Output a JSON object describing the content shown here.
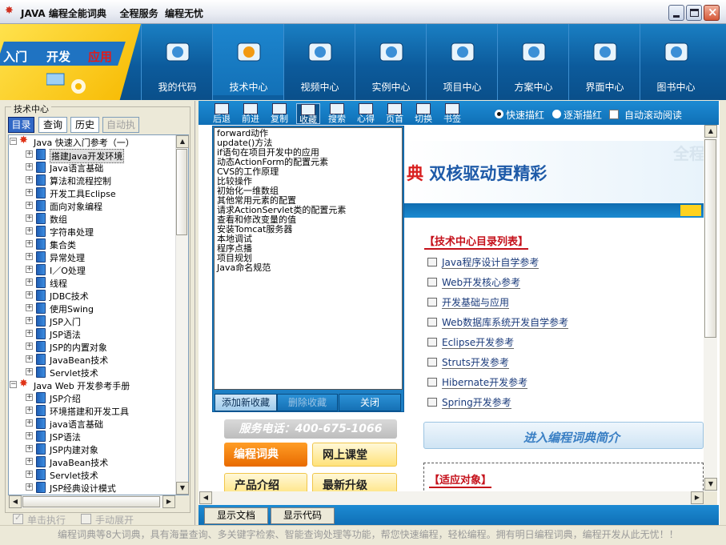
{
  "window": {
    "title": "JAVA 编程全能词典    全程服务  编程无忧"
  },
  "logo": {
    "words": [
      "入门",
      "开发",
      "应用"
    ]
  },
  "nav": {
    "tabs": [
      {
        "label": "我的代码",
        "icon": "user-code-icon"
      },
      {
        "label": "技术中心",
        "icon": "gears-icon",
        "active": true
      },
      {
        "label": "视频中心",
        "icon": "film-icon"
      },
      {
        "label": "实例中心",
        "icon": "monitors-icon"
      },
      {
        "label": "项目中心",
        "icon": "chart-doc-icon"
      },
      {
        "label": "方案中心",
        "icon": "folder-icon"
      },
      {
        "label": "界面中心",
        "icon": "palette-icon"
      },
      {
        "label": "图书中心",
        "icon": "disk-icon"
      }
    ]
  },
  "left": {
    "legend": "技术中心",
    "tabs": [
      "目录",
      "查询",
      "历史",
      "自动执行"
    ],
    "tree": [
      {
        "level": 0,
        "type": "star",
        "label": "Java 快速入门参考（一）"
      },
      {
        "level": 1,
        "type": "book",
        "label": "搭建Java开发环境",
        "selected": true
      },
      {
        "level": 1,
        "type": "book",
        "label": "Java语言基础"
      },
      {
        "level": 1,
        "type": "book",
        "label": "算法和流程控制"
      },
      {
        "level": 1,
        "type": "book",
        "label": "开发工具Eclipse"
      },
      {
        "level": 1,
        "type": "book",
        "label": "面向对象编程"
      },
      {
        "level": 1,
        "type": "book",
        "label": "数组"
      },
      {
        "level": 1,
        "type": "book",
        "label": "字符串处理"
      },
      {
        "level": 1,
        "type": "book",
        "label": "集合类"
      },
      {
        "level": 1,
        "type": "book",
        "label": "异常处理"
      },
      {
        "level": 1,
        "type": "book",
        "label": "I／O处理"
      },
      {
        "level": 1,
        "type": "book",
        "label": "线程"
      },
      {
        "level": 1,
        "type": "book",
        "label": "JDBC技术"
      },
      {
        "level": 1,
        "type": "book",
        "label": "使用Swing"
      },
      {
        "level": 1,
        "type": "book",
        "label": "JSP入门"
      },
      {
        "level": 1,
        "type": "book",
        "label": "JSP语法"
      },
      {
        "level": 1,
        "type": "book",
        "label": "JSP的内置对象"
      },
      {
        "level": 1,
        "type": "book",
        "label": "JavaBean技术"
      },
      {
        "level": 1,
        "type": "book",
        "label": "Servlet技术"
      },
      {
        "level": 0,
        "type": "star",
        "label": "Java Web 开发参考手册"
      },
      {
        "level": 1,
        "type": "book",
        "label": "JSP介绍"
      },
      {
        "level": 1,
        "type": "book",
        "label": "环境搭建和开发工具"
      },
      {
        "level": 1,
        "type": "book",
        "label": "java语言基础"
      },
      {
        "level": 1,
        "type": "book",
        "label": "JSP语法"
      },
      {
        "level": 1,
        "type": "book",
        "label": "JSP内建对象"
      },
      {
        "level": 1,
        "type": "book",
        "label": "JavaBean技术"
      },
      {
        "level": 1,
        "type": "book",
        "label": "Servlet技术"
      },
      {
        "level": 1,
        "type": "book",
        "label": "JSP经典设计模式"
      }
    ],
    "checks": [
      "单击执行",
      "手动展开"
    ]
  },
  "toolbar": {
    "buttons": [
      "后退",
      "前进",
      "复制",
      "收藏",
      "搜索",
      "心得",
      "页首",
      "切换",
      "书签"
    ],
    "pressed": "收藏",
    "radios": [
      {
        "label": "快速描红",
        "on": true
      },
      {
        "label": "逐渐描红",
        "on": false
      }
    ],
    "check": "自动滚动阅读"
  },
  "web": {
    "banner_red": "典",
    "banner_blue": " 双核驱动更精彩",
    "banner_watermark": "全程",
    "toc_head": "【技术中心目录列表】",
    "toc": [
      "Java程序设计自学参考",
      "Web开发核心参考",
      "开发基础与应用",
      "Web数据库系统开发自学参考",
      "Eclipse开发参考",
      "Struts开发参考",
      "Hibernate开发参考",
      "Spring开发参考"
    ],
    "enter": "进入编程词典简介",
    "fit_head": "【适应对象】",
    "phone": "服务电话：400-675-1066",
    "promos": [
      "编程词典",
      "网上课堂",
      "产品介绍",
      "最新升级"
    ]
  },
  "favorites": {
    "items": [
      "forward动作",
      "update()方法",
      "if语句在项目开发中的应用",
      "动态ActionForm的配置元素",
      "CVS的工作原理",
      "比较操作",
      "初始化一维数组",
      "其他常用元素的配置",
      "请求ActionServlet类的配置元素",
      "查看和修改变量的值",
      "安装Tomcat服务器",
      "本地调试",
      "程序点播",
      "项目规划",
      "Java命名规范"
    ],
    "add": "添加新收藏",
    "delete": "删除收藏",
    "close": "关闭"
  },
  "bottom": {
    "doc": "显示文档",
    "code": "显示代码"
  },
  "status": "编程词典等8大词典，具有海量查询、多关键字检索、智能查询处理等功能，帮您快速编程，轻松编程。拥有明日编程词典，编程开发从此无忧！！"
}
